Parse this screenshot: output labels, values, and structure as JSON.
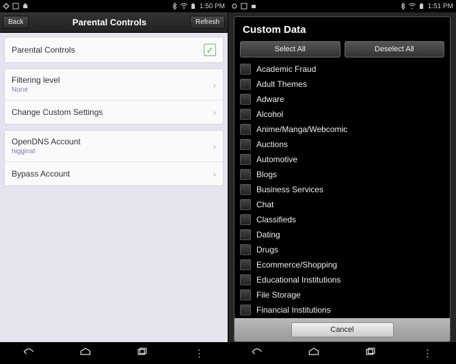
{
  "status": {
    "time_left": "1:50 PM",
    "time_right": "1:51 PM"
  },
  "left": {
    "back": "Back",
    "title": "Parental Controls",
    "refresh": "Refresh",
    "group1": [
      {
        "title": "Parental Controls",
        "type": "toggle",
        "checked": true
      }
    ],
    "group2": [
      {
        "title": "Filtering level",
        "sub": "None",
        "type": "nav"
      },
      {
        "title": "Change Custom Settings",
        "type": "nav"
      }
    ],
    "group3": [
      {
        "title": "OpenDNS Account",
        "sub": "higginst",
        "type": "nav"
      },
      {
        "title": "Bypass Account",
        "type": "nav"
      }
    ]
  },
  "right": {
    "modal_title": "Custom Data",
    "select_all": "Select All",
    "deselect_all": "Deselect All",
    "cancel": "Cancel",
    "categories": [
      "Academic Fraud",
      "Adult Themes",
      "Adware",
      "Alcohol",
      "Anime/Manga/Webcomic",
      "Auctions",
      "Automotive",
      "Blogs",
      "Business Services",
      "Chat",
      "Classifieds",
      "Dating",
      "Drugs",
      "Ecommerce/Shopping",
      "Educational Institutions",
      "File Storage",
      "Financial Institutions"
    ]
  }
}
